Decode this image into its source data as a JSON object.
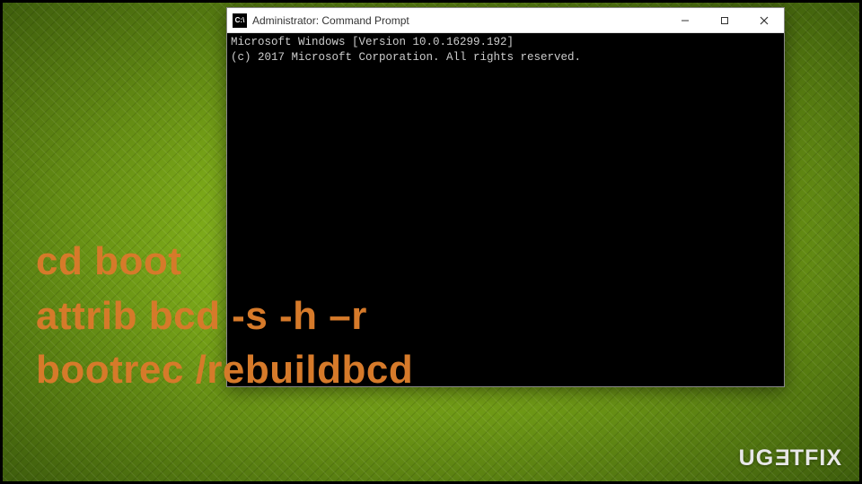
{
  "window": {
    "icon_label": "C:\\",
    "title": "Administrator: Command Prompt"
  },
  "console": {
    "line1": "Microsoft Windows [Version 10.0.16299.192]",
    "line2": "(c) 2017 Microsoft Corporation. All rights reserved."
  },
  "overlay": {
    "line1": "cd boot",
    "line2": "attrib bcd -s -h –r",
    "line3": "bootrec /rebuildbcd"
  },
  "watermark": {
    "part1": "UG",
    "flipped": "E",
    "part2": "TFIX"
  }
}
